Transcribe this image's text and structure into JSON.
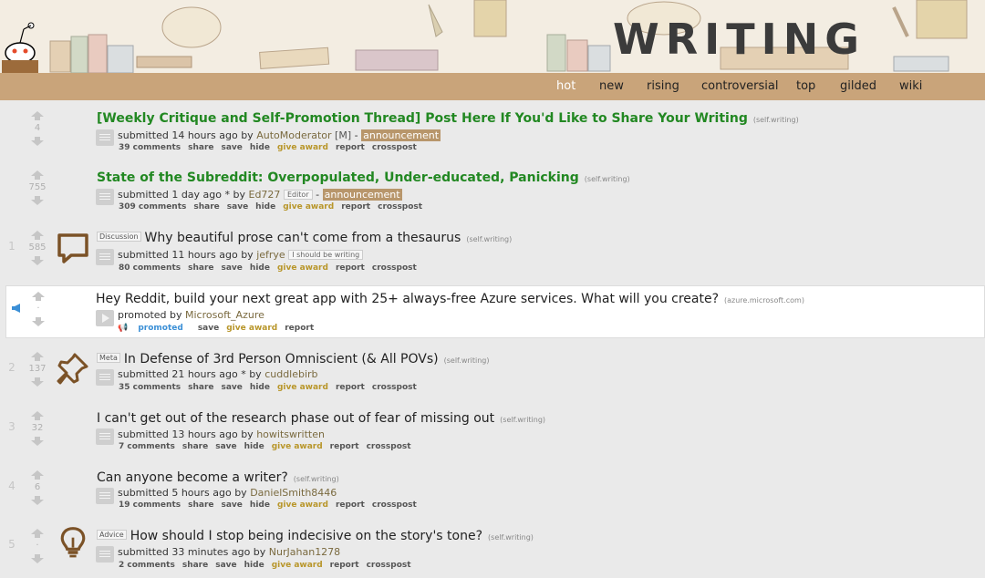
{
  "header": {
    "title": "WRITING"
  },
  "nav": {
    "tabs": [
      "hot",
      "new",
      "rising",
      "controversial",
      "top",
      "gilded",
      "wiki"
    ],
    "active": "hot"
  },
  "posts": [
    {
      "rank": "",
      "score": "4",
      "title": "[Weekly Critique and Self-Promotion Thread] Post Here If You'd Like to Share Your Writing",
      "domain": "(self.writing)",
      "flair": "",
      "submitted": "submitted 14 hours ago by",
      "author": "AutoModerator",
      "mod": "[M]",
      "dash": "-",
      "announcement": "announcement",
      "actions": [
        "39 comments",
        "share",
        "save",
        "hide",
        "give award",
        "report",
        "crosspost"
      ]
    },
    {
      "rank": "",
      "score": "755",
      "title": "State of the Subreddit: Overpopulated, Under-educated, Panicking",
      "domain": "(self.writing)",
      "flair": "",
      "submitted": "submitted 1 day ago * by",
      "author": "Ed727",
      "user_flair": "Editor",
      "dash": "-",
      "announcement": "announcement",
      "actions": [
        "309 comments",
        "share",
        "save",
        "hide",
        "give award",
        "report",
        "crosspost"
      ]
    },
    {
      "rank": "1",
      "score": "585",
      "title": "Why beautiful prose can't come from a thesaurus",
      "domain": "(self.writing)",
      "flair": "Discussion",
      "submitted": "submitted 11 hours ago by",
      "author": "jefrye",
      "user_flair": "I should be writing",
      "actions": [
        "80 comments",
        "share",
        "save",
        "hide",
        "give award",
        "report",
        "crosspost"
      ]
    },
    {
      "rank": "",
      "score": "·",
      "title": "Hey Reddit, build your next great app with 25+ always-free Azure services. What will you create?",
      "domain": "(azure.microsoft.com)",
      "submitted": "promoted by",
      "author": "Microsoft_Azure",
      "promoted_label": "promoted",
      "actions": [
        "save",
        "give award",
        "report"
      ]
    },
    {
      "rank": "2",
      "score": "137",
      "title": "In Defense of 3rd Person Omniscient (& All POVs)",
      "domain": "(self.writing)",
      "flair": "Meta",
      "submitted": "submitted 21 hours ago * by",
      "author": "cuddlebirb",
      "actions": [
        "35 comments",
        "share",
        "save",
        "hide",
        "give award",
        "report",
        "crosspost"
      ]
    },
    {
      "rank": "3",
      "score": "32",
      "title": "I can't get out of the research phase out of fear of missing out",
      "domain": "(self.writing)",
      "flair": "",
      "submitted": "submitted 13 hours ago by",
      "author": "howitswritten",
      "actions": [
        "7 comments",
        "share",
        "save",
        "hide",
        "give award",
        "report",
        "crosspost"
      ]
    },
    {
      "rank": "4",
      "score": "6",
      "title": "Can anyone become a writer?",
      "domain": "(self.writing)",
      "flair": "",
      "submitted": "submitted 5 hours ago by",
      "author": "DanielSmith8446",
      "actions": [
        "19 comments",
        "share",
        "save",
        "hide",
        "give award",
        "report",
        "crosspost"
      ]
    },
    {
      "rank": "5",
      "score": "·",
      "title": "How should I stop being indecisive on the story's tone?",
      "domain": "(self.writing)",
      "flair": "Advice",
      "submitted": "submitted 33 minutes ago by",
      "author": "NurJahan1278",
      "actions": [
        "2 comments",
        "share",
        "save",
        "hide",
        "give award",
        "report",
        "crosspost"
      ]
    }
  ],
  "colors": {
    "nav_bg": "#c9a47a",
    "sticky_title": "#228822",
    "announcement_bg": "#b8966b",
    "award": "#b8962a",
    "icon_brown": "#7b5227"
  }
}
